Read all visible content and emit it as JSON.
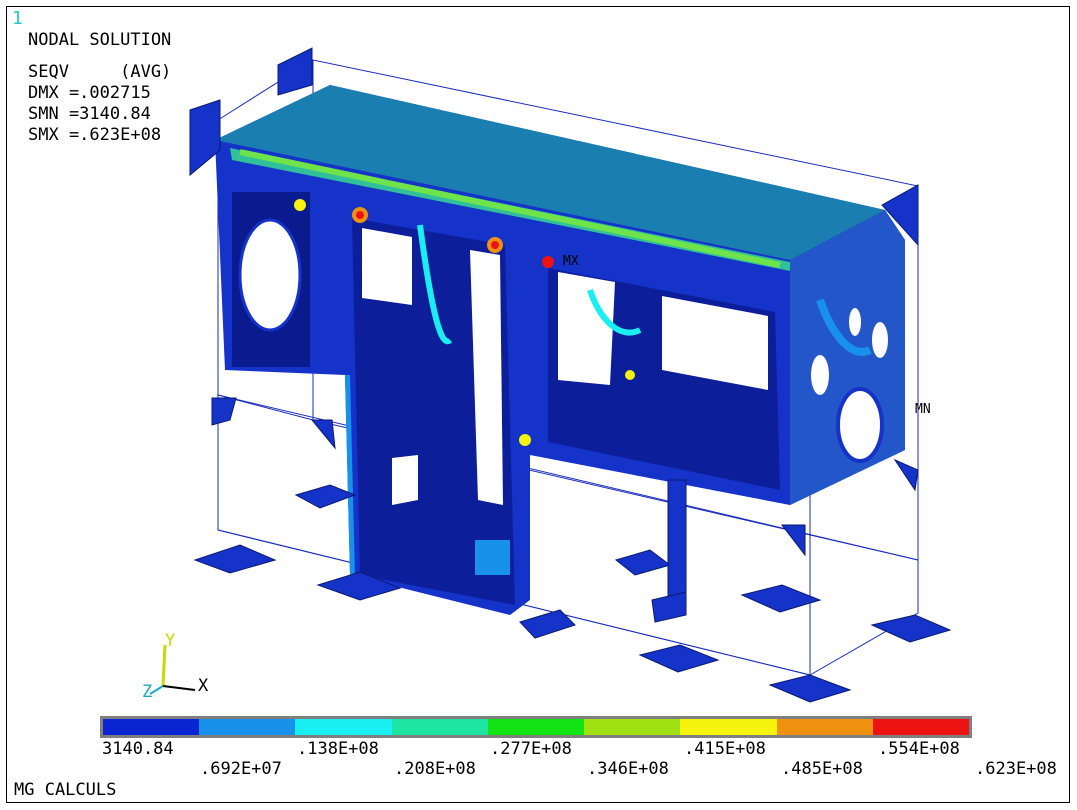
{
  "window_number": "1",
  "header": {
    "line1": "NODAL SOLUTION",
    "line2": "SEQV     (AVG)",
    "line3": "DMX =.002715",
    "line4": "SMN =3140.84",
    "line5": "SMX =.623E+08"
  },
  "markers": {
    "max": "MX",
    "min": "MN"
  },
  "triad": {
    "y": "Y",
    "x": "X",
    "z": "Z"
  },
  "legend": {
    "colors": [
      "#0000ff",
      "#0090ff",
      "#00ffff",
      "#00e8b0",
      "#00f000",
      "#a8f000",
      "#ffff00",
      "#ffa000",
      "#ff0000"
    ],
    "colors_actual": [
      "#0a25d2",
      "#1891ea",
      "#19eef0",
      "#1ee6a2",
      "#12e312",
      "#9ee011",
      "#f6f30d",
      "#f0910f",
      "#ee1313"
    ],
    "labels_top": [
      "3140.84",
      ".138E+08",
      ".277E+08",
      ".415E+08",
      ".554E+08"
    ],
    "labels_bottom": [
      ".692E+07",
      ".208E+08",
      ".346E+08",
      ".485E+08",
      ".623E+08"
    ]
  },
  "footer": "MG CALCULS"
}
